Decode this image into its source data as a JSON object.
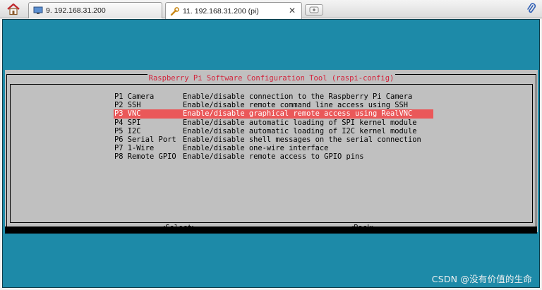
{
  "tabs": [
    {
      "label": "9. 192.168.31.200",
      "active": false
    },
    {
      "label": "11. 192.168.31.200 (pi)",
      "active": true,
      "close": "✕"
    }
  ],
  "dialog": {
    "title": "Raspberry Pi Software Configuration Tool (raspi-config)",
    "items": [
      {
        "key": "P1 Camera",
        "desc": "Enable/disable connection to the Raspberry Pi Camera",
        "selected": false
      },
      {
        "key": "P2 SSH",
        "desc": "Enable/disable remote command line access using SSH",
        "selected": false
      },
      {
        "key": "P3 VNC",
        "desc": "Enable/disable graphical remote access using RealVNC",
        "selected": true
      },
      {
        "key": "P4 SPI",
        "desc": "Enable/disable automatic loading of SPI kernel module",
        "selected": false
      },
      {
        "key": "P5 I2C",
        "desc": "Enable/disable automatic loading of I2C kernel module",
        "selected": false
      },
      {
        "key": "P6 Serial Port",
        "desc": "Enable/disable shell messages on the serial connection",
        "selected": false
      },
      {
        "key": "P7 1-Wire",
        "desc": "Enable/disable one-wire interface",
        "selected": false
      },
      {
        "key": "P8 Remote GPIO",
        "desc": "Enable/disable remote access to GPIO pins",
        "selected": false
      }
    ],
    "select_label": "<Select>",
    "back_label": "<Back>"
  },
  "watermark": "CSDN @没有价值的生命",
  "colors": {
    "terminal_bg": "#1d8aa8",
    "dialog_bg": "#c0c0c0",
    "title_text": "#d2233b",
    "selection_bg": "#ea5859"
  },
  "icons": {
    "home": "home-icon",
    "session": "monitor-icon",
    "active_session": "wrench-icon",
    "new_tab": "add-tab-icon",
    "attach": "paperclip-icon"
  }
}
